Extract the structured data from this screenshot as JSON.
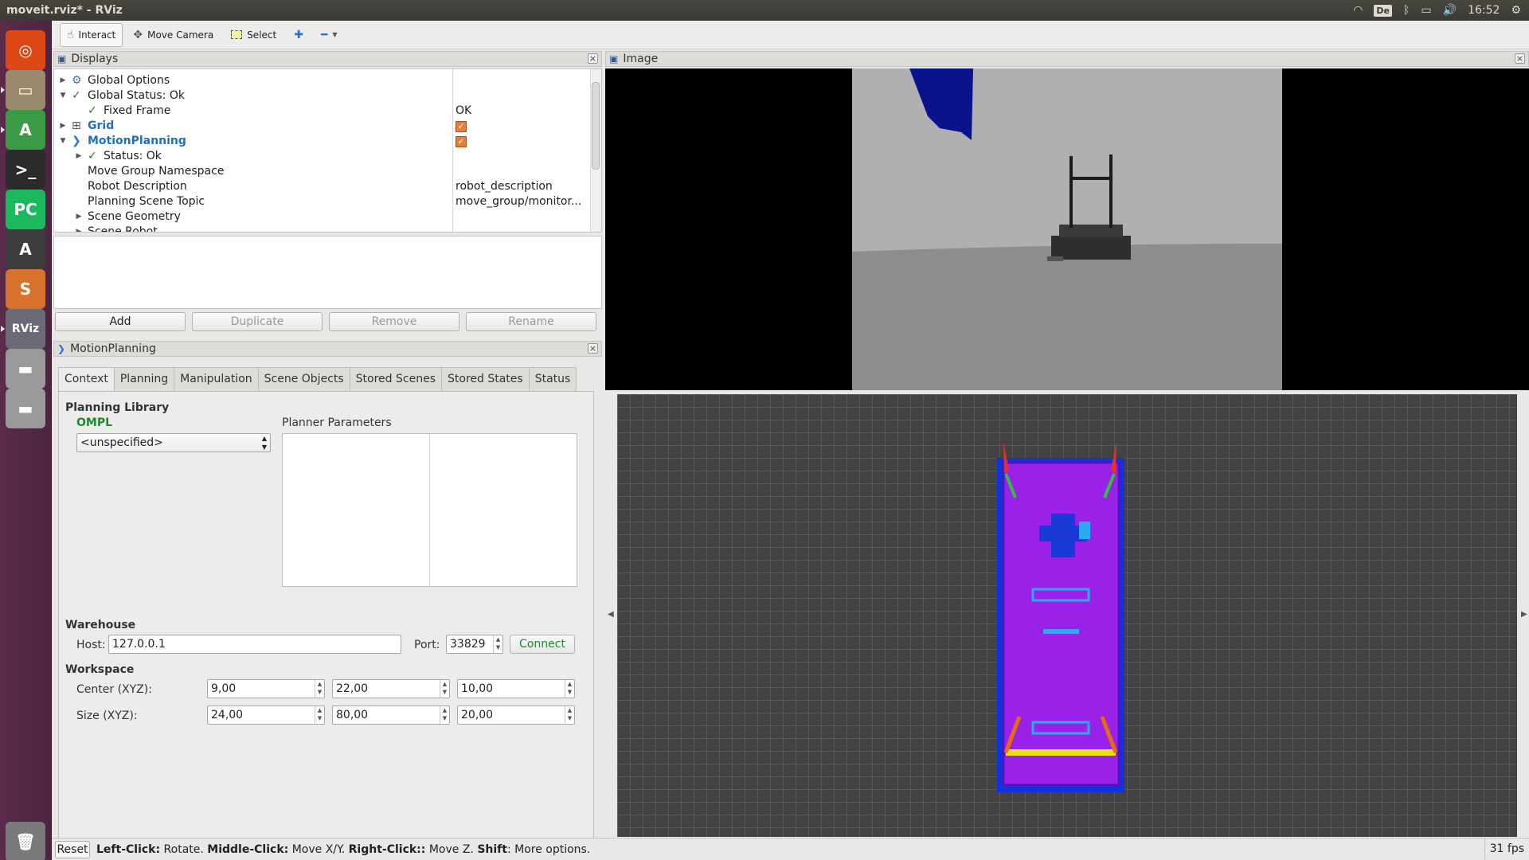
{
  "window": {
    "title": "moveit.rviz* - RViz"
  },
  "tray": {
    "keyboard": "De",
    "time": "16:52"
  },
  "launcher": {
    "items": [
      {
        "name": "ubuntu-dash-icon",
        "glyph": "◎",
        "color": "#dd4814"
      },
      {
        "name": "files-icon",
        "glyph": "▭",
        "color": "#9b8a6e"
      },
      {
        "name": "android-studio-icon",
        "glyph": "A",
        "color": "#3a9a46"
      },
      {
        "name": "terminal-icon",
        "glyph": ">_",
        "color": "#2b2b2b"
      },
      {
        "name": "pycharm-icon",
        "glyph": "PC",
        "color": "#1bb85e"
      },
      {
        "name": "software-updater-icon",
        "glyph": "A",
        "color": "#3c3c3c"
      },
      {
        "name": "sublime-text-icon",
        "glyph": "S",
        "color": "#d6722b"
      },
      {
        "name": "rviz-icon",
        "glyph": "RViz",
        "color": "#6b6b78"
      },
      {
        "name": "drive-icon-1",
        "glyph": "▬",
        "color": "#9a9a9a"
      },
      {
        "name": "drive-icon-2",
        "glyph": "▬",
        "color": "#9a9a9a"
      },
      {
        "name": "trash-icon",
        "glyph": "🗑",
        "color": "#7a7a7a"
      }
    ]
  },
  "toolbar": {
    "interact": "Interact",
    "move_camera": "Move Camera",
    "select": "Select"
  },
  "displays": {
    "title": "Displays",
    "rows": [
      {
        "label": "Global Options",
        "value": ""
      },
      {
        "label": "Global Status: Ok",
        "value": ""
      },
      {
        "label": "Fixed Frame",
        "value": "OK"
      },
      {
        "label": "Grid",
        "value": ""
      },
      {
        "label": "MotionPlanning",
        "value": ""
      },
      {
        "label": "Status: Ok",
        "value": ""
      },
      {
        "label": "Move Group Namespace",
        "value": ""
      },
      {
        "label": "Robot Description",
        "value": "robot_description"
      },
      {
        "label": "Planning Scene Topic",
        "value": "move_group/monitor..."
      },
      {
        "label": "Scene Geometry",
        "value": ""
      },
      {
        "label": "Scene Robot",
        "value": ""
      }
    ],
    "buttons": {
      "add": "Add",
      "duplicate": "Duplicate",
      "remove": "Remove",
      "rename": "Rename"
    }
  },
  "motion_planning": {
    "title": "MotionPlanning",
    "tabs": [
      "Context",
      "Planning",
      "Manipulation",
      "Scene Objects",
      "Stored Scenes",
      "Stored States",
      "Status"
    ],
    "planning_library": {
      "heading": "Planning Library",
      "library": "OMPL",
      "planner": "<unspecified>",
      "params_heading": "Planner Parameters"
    },
    "warehouse": {
      "heading": "Warehouse",
      "host_label": "Host:",
      "host": "127.0.0.1",
      "port_label": "Port:",
      "port": "33829",
      "connect": "Connect"
    },
    "workspace": {
      "heading": "Workspace",
      "center_label": "Center (XYZ):",
      "center": [
        "9,00",
        "22,00",
        "10,00"
      ],
      "size_label": "Size (XYZ):",
      "size": [
        "24,00",
        "80,00",
        "20,00"
      ]
    }
  },
  "image_panel": {
    "title": "Image"
  },
  "statusbar": {
    "reset": "Reset",
    "hint_parts": [
      {
        "bold": "Left-Click:",
        "text": " Rotate. "
      },
      {
        "bold": "Middle-Click:",
        "text": " Move X/Y. "
      },
      {
        "bold": "Right-Click::",
        "text": " Move Z. "
      },
      {
        "bold": "Shift",
        "text": ": More options."
      }
    ],
    "fps": "31 fps"
  }
}
